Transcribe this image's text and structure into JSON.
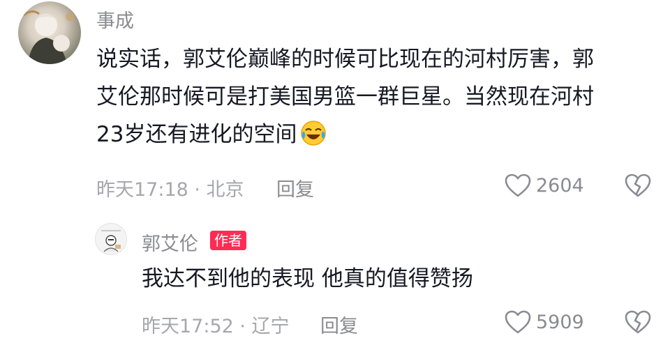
{
  "comments": [
    {
      "username": "事成",
      "text_lines": [
        "说实话，郭艾伦巅峰的时候可比现在的河村厉害，郭",
        "艾伦那时候可是打美国男篮一群巨星。当然现在河村",
        "23岁还有进化的空间"
      ],
      "emoji": "laughing-crying-emoji",
      "meta": "昨天17:18 · 北京",
      "reply_label": "回复",
      "likes": "2604"
    },
    {
      "username": "郭艾伦",
      "badge": "作者",
      "text": "我达不到他的表现 他真的值得赞扬",
      "meta": "昨天17:52 · 辽宁",
      "reply_label": "回复",
      "likes": "5909"
    }
  ],
  "colors": {
    "badge": "#fe2c55",
    "muted": "#8a8b91",
    "text": "#161823"
  }
}
